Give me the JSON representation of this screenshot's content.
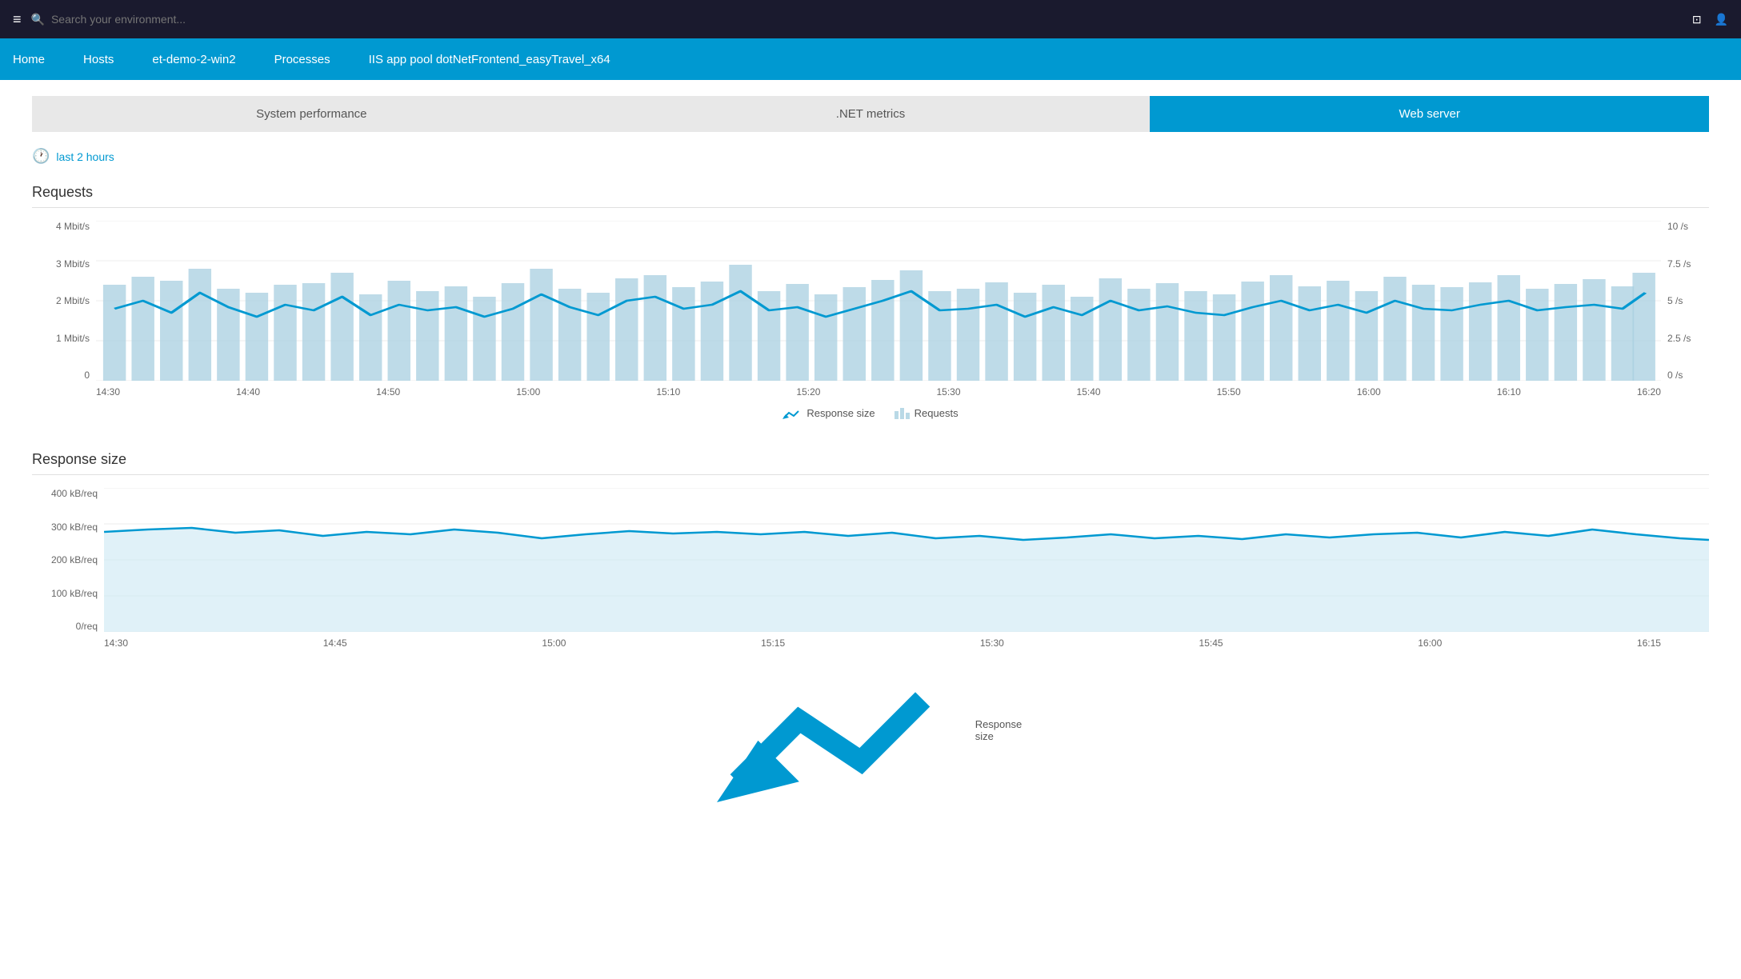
{
  "topNav": {
    "searchPlaceholder": "Search your environment...",
    "menuIcon": "≡"
  },
  "breadcrumbs": [
    {
      "label": "Home",
      "id": "home"
    },
    {
      "label": "Hosts",
      "id": "hosts"
    },
    {
      "label": "et-demo-2-win2",
      "id": "host-detail"
    },
    {
      "label": "Processes",
      "id": "processes"
    },
    {
      "label": "IIS app pool dotNetFrontend_easyTravel_x64",
      "id": "iis-pool"
    }
  ],
  "tabs": [
    {
      "label": "System performance",
      "active": false,
      "id": "system-perf"
    },
    {
      "label": ".NET metrics",
      "active": false,
      "id": "net-metrics"
    },
    {
      "label": "Web server",
      "active": true,
      "id": "web-server"
    }
  ],
  "timeFilter": {
    "label": "last 2 hours"
  },
  "requestsSection": {
    "title": "Requests",
    "yAxisLeft": [
      "4 Mbit/s",
      "3 Mbit/s",
      "2 Mbit/s",
      "1 Mbit/s",
      "0"
    ],
    "yAxisRight": [
      "10 /s",
      "7.5 /s",
      "5 /s",
      "2.5 /s",
      "0 /s"
    ],
    "xAxisLabels": [
      "14:30",
      "14:40",
      "14:50",
      "15:00",
      "15:10",
      "15:20",
      "15:30",
      "15:40",
      "15:50",
      "16:00",
      "16:10",
      "16:20"
    ],
    "legend": {
      "responseSizeLabel": "Response size",
      "requestsLabel": "Requests"
    }
  },
  "responseSizeSection": {
    "title": "Response size",
    "yAxisLeft": [
      "400 kB/req",
      "300 kB/req",
      "200 kB/req",
      "100 kB/req",
      "0/req"
    ],
    "xAxisLabels": [
      "14:30",
      "14:45",
      "15:00",
      "15:15",
      "15:30",
      "15:45",
      "16:00",
      "16:15"
    ],
    "legend": {
      "responseSizeLabel": "Response size"
    }
  },
  "colors": {
    "primary": "#0099d1",
    "barFill": "#a8cfe0",
    "areaFill": "#cce8f4",
    "linePrimary": "#0099d1",
    "activeTab": "#0099d1",
    "breadcrumbBg": "#0099d1",
    "navBg": "#1a1a2e"
  }
}
